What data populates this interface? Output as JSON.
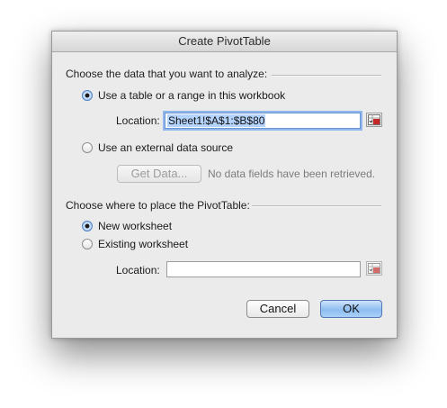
{
  "dialog": {
    "title": "Create PivotTable"
  },
  "data_section": {
    "heading": "Choose the data that you want to analyze:",
    "option_range_label": "Use a table or a range in this workbook",
    "option_range_selected": true,
    "location_label": "Location:",
    "location_value": "Sheet1!$A$1:$B$80",
    "option_external_label": "Use an external data source",
    "option_external_selected": false,
    "get_data_button": "Get Data...",
    "no_data_text": "No data fields have been retrieved."
  },
  "place_section": {
    "heading": "Choose where to place the PivotTable:",
    "option_new_label": "New worksheet",
    "option_new_selected": true,
    "option_existing_label": "Existing worksheet",
    "option_existing_selected": false,
    "location_label": "Location:",
    "location_value": ""
  },
  "buttons": {
    "cancel": "Cancel",
    "ok": "OK"
  },
  "colors": {
    "accent": "#8ebdf1",
    "selection": "#b5d4fd"
  }
}
